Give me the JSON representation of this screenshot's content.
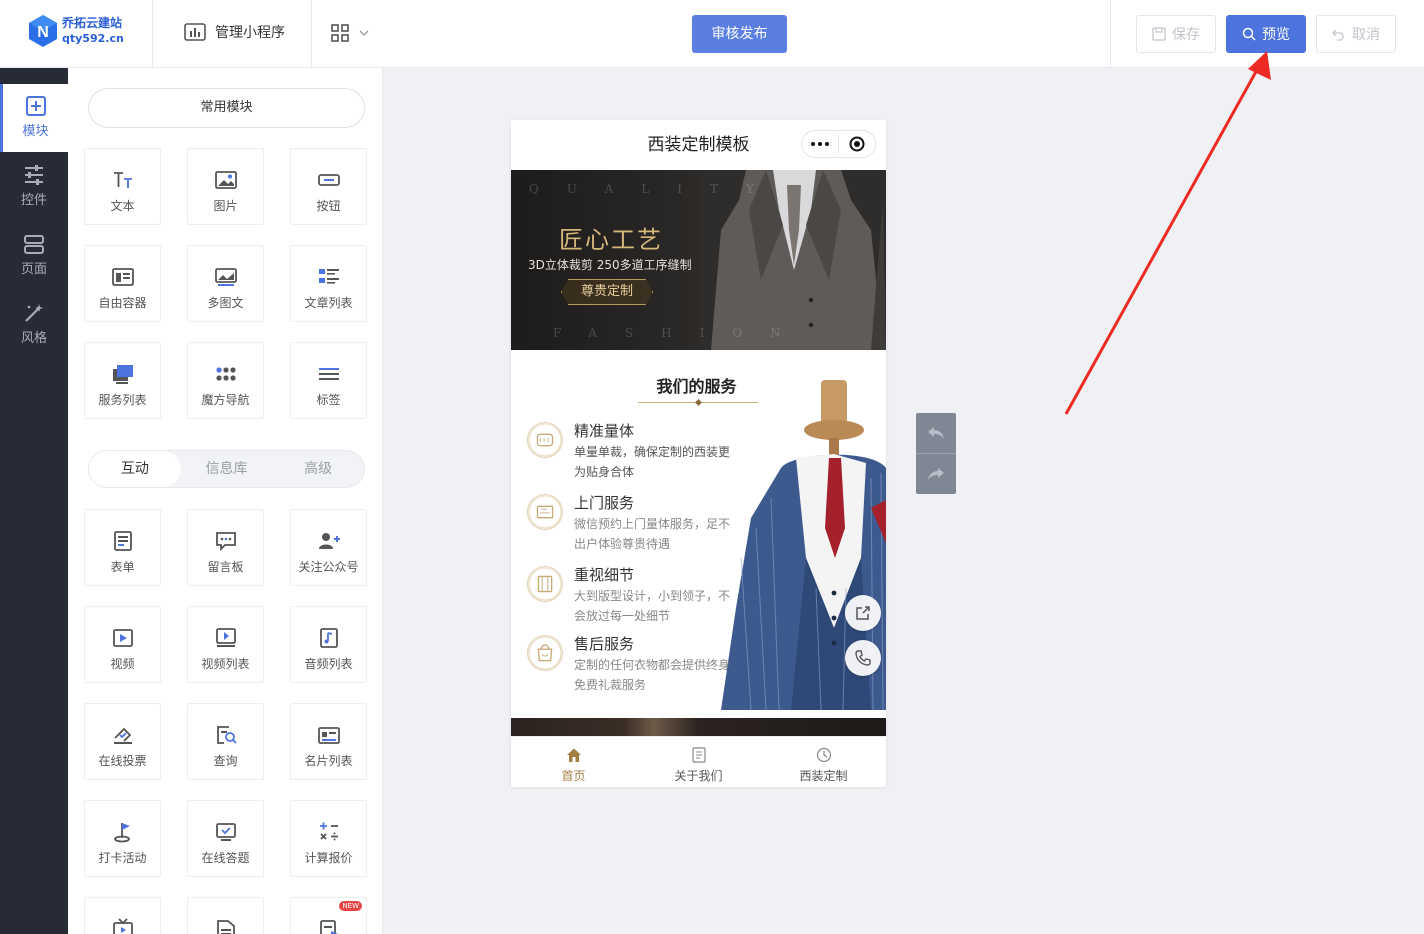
{
  "brand": {
    "name": "乔拓云建站",
    "domain": "qty592.cn"
  },
  "topbar": {
    "manage_label": "管理小程序",
    "publish_label": "审核发布",
    "save_label": "保存",
    "preview_label": "预览",
    "cancel_label": "取消"
  },
  "rail": [
    {
      "label": "模块",
      "icon": "plus-square-icon",
      "active": true
    },
    {
      "label": "控件",
      "icon": "sliders-icon"
    },
    {
      "label": "页面",
      "icon": "pages-icon"
    },
    {
      "label": "风格",
      "icon": "magic-wand-icon"
    }
  ],
  "panel": {
    "common_label": "常用模块",
    "common_modules": [
      "文本",
      "图片",
      "按钮",
      "自由容器",
      "多图文",
      "文章列表",
      "服务列表",
      "魔方导航",
      "标签"
    ],
    "tabs": [
      "互动",
      "信息库",
      "高级"
    ],
    "active_tab": "互动",
    "interactive_modules": [
      "表单",
      "留言板",
      "关注公众号",
      "视频",
      "视频列表",
      "音频列表",
      "在线投票",
      "查询",
      "名片列表",
      "打卡活动",
      "在线答题",
      "计算报价"
    ],
    "new_badge": "NEW"
  },
  "phone": {
    "title": "西装定制模板",
    "banner": {
      "faint_top": "QUALITY",
      "faint_bottom": "FASHION",
      "headline": "匠心工艺",
      "subline": "3D立体裁剪 250多道工序缝制",
      "tag": "尊贵定制"
    },
    "services": {
      "title": "我们的服务",
      "items": [
        {
          "title": "精准量体",
          "desc": "单量单裁，确保定制的西装更为贴身合体"
        },
        {
          "title": "上门服务",
          "desc": "微信预约上门量体服务，足不出户体验尊贵待遇"
        },
        {
          "title": "重视细节",
          "desc": "大到版型设计，小到领子，不会放过每一处细节"
        },
        {
          "title": "售后服务",
          "desc": "定制的任何衣物都会提供终身免费礼裁服务"
        }
      ]
    },
    "tabbar": [
      "首页",
      "关于我们",
      "西装定制"
    ],
    "active_tab": "首页"
  },
  "colors": {
    "accent": "#4d73de",
    "publish": "#5b7fe0",
    "rail": "#262b36",
    "gold": "#a47d42",
    "arrow": "#ee2a24"
  }
}
